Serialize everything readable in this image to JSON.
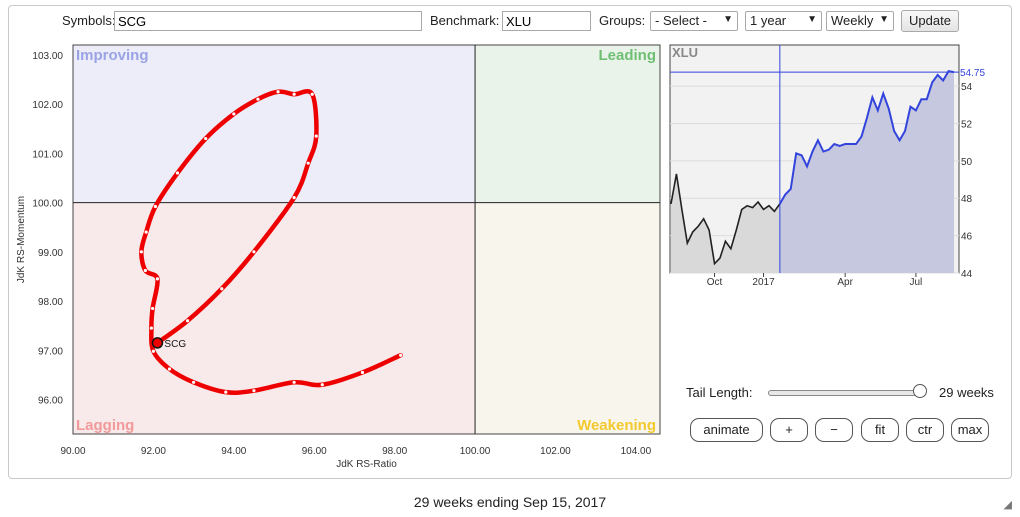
{
  "toolbar": {
    "symbols_label": "Symbols:",
    "symbols_value": "SCG",
    "benchmark_label": "Benchmark:",
    "benchmark_value": "XLU",
    "groups_label": "Groups:",
    "groups_value": "- Select -",
    "period_value": "1 year",
    "frequency_value": "Weekly",
    "update_label": "Update"
  },
  "controls": {
    "tail_label": "Tail Length:",
    "tail_value": "29 weeks",
    "tail_weeks": 29,
    "animate_label": "animate",
    "plus_label": "+",
    "minus_label": "−",
    "fit_label": "fit",
    "ctr_label": "ctr",
    "max_label": "max"
  },
  "caption": "29 weeks ending Sep 15, 2017",
  "chart_data": [
    {
      "type": "scatter",
      "xlabel": "JdK RS-Ratio",
      "ylabel": "JdK RS-Momentum",
      "xlim": [
        90,
        104.6
      ],
      "ylim": [
        95.3,
        103.2
      ],
      "center": [
        100,
        100
      ],
      "xticks": [
        "90.00",
        "92.00",
        "94.00",
        "96.00",
        "98.00",
        "100.00",
        "102.00",
        "104.00"
      ],
      "yticks": [
        "96.00",
        "97.00",
        "98.00",
        "99.00",
        "100.00",
        "101.00",
        "102.00",
        "103.00"
      ],
      "quadrants": {
        "improving": {
          "label": "Improving",
          "color": "#9aa3e6"
        },
        "leading": {
          "label": "Leading",
          "color": "#6fbf73"
        },
        "lagging": {
          "label": "Lagging",
          "color": "#f29a9a"
        },
        "weakening": {
          "label": "Weakening",
          "color": "#f3c92e"
        }
      },
      "series": [
        {
          "name": "SCG",
          "color": "#ee0000",
          "points": [
            [
              98.15,
              96.9
            ],
            [
              97.2,
              96.55
            ],
            [
              96.2,
              96.3
            ],
            [
              95.5,
              96.35
            ],
            [
              94.5,
              96.18
            ],
            [
              93.8,
              96.15
            ],
            [
              93.0,
              96.35
            ],
            [
              92.4,
              96.62
            ],
            [
              92.0,
              96.98
            ],
            [
              91.95,
              97.45
            ],
            [
              91.98,
              97.85
            ],
            [
              92.1,
              98.45
            ],
            [
              91.8,
              98.62
            ],
            [
              91.7,
              99.0
            ],
            [
              91.82,
              99.4
            ],
            [
              92.05,
              99.92
            ],
            [
              92.6,
              100.6
            ],
            [
              93.3,
              101.3
            ],
            [
              94.0,
              101.8
            ],
            [
              94.6,
              102.1
            ],
            [
              95.1,
              102.25
            ],
            [
              95.5,
              102.2
            ],
            [
              95.95,
              102.2
            ],
            [
              96.05,
              101.35
            ],
            [
              95.85,
              100.8
            ],
            [
              95.5,
              100.1
            ],
            [
              94.5,
              99.0
            ],
            [
              93.7,
              98.25
            ],
            [
              92.85,
              97.6
            ],
            [
              92.1,
              97.15
            ]
          ],
          "current": [
            92.1,
            97.15
          ]
        }
      ]
    },
    {
      "type": "area",
      "title": "XLU",
      "series_name": "XLU",
      "last_value_label": "54.75",
      "last_value": 54.75,
      "ylim": [
        44,
        56.2
      ],
      "yticks": [
        "44",
        "46",
        "48",
        "50",
        "52",
        "54"
      ],
      "xticks": [
        "Oct",
        "2017",
        "Apr",
        "Jul"
      ],
      "highlight_start_index": 20,
      "values": [
        47.7,
        49.3,
        47.4,
        45.6,
        46.2,
        46.5,
        46.9,
        46.3,
        44.5,
        44.8,
        45.7,
        45.3,
        46.3,
        47.4,
        47.6,
        47.5,
        47.8,
        47.4,
        47.6,
        47.3,
        47.7,
        48.2,
        48.5,
        50.4,
        50.3,
        49.7,
        50.5,
        51.1,
        50.5,
        50.6,
        50.9,
        50.8,
        50.9,
        50.9,
        50.9,
        51.3,
        52.3,
        53.4,
        52.7,
        53.6,
        52.8,
        51.6,
        51.1,
        51.6,
        52.9,
        52.7,
        53.3,
        53.3,
        54.2,
        54.6,
        54.3,
        54.8,
        54.75
      ]
    }
  ]
}
